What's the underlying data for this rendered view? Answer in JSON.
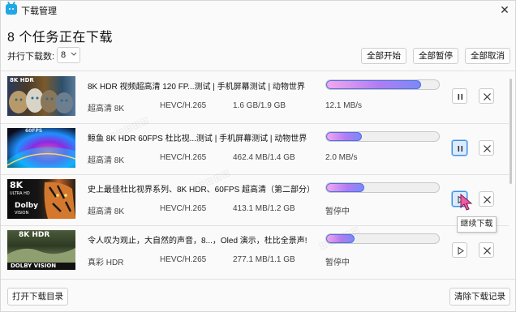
{
  "window": {
    "title": "下载管理",
    "close_glyph": "✕"
  },
  "header": {
    "heading": "8 个任务正在下载",
    "concurrency_label": "并行下载数:",
    "concurrency_value": "8",
    "buttons": {
      "start_all": "全部开始",
      "pause_all": "全部暂停",
      "cancel_all": "全部取消"
    }
  },
  "tasks": [
    {
      "title": "8K HDR 视频超高清 120 FP...测试 | 手机屏幕测试 | 动物世界",
      "quality": "超高清 8K",
      "codec": "HEVC/H.265",
      "size": "1.6 GB/1.9 GB",
      "status": "12.1 MB/s",
      "progress": 0.84,
      "thumb_badge": "8K HDR",
      "state": "downloading",
      "icons": {
        "toggle": "pause-icon",
        "cancel": "close-icon"
      }
    },
    {
      "title": "鲸鱼 8K HDR 60FPS 杜比视...测试 | 手机屏幕测试 | 动物世界",
      "quality": "超高清 8K",
      "codec": "HEVC/H.265",
      "size": "462.4 MB/1.4 GB",
      "status": "2.0 MB/s",
      "progress": 0.32,
      "thumb_badge": "60FPS",
      "state": "downloading",
      "icons": {
        "toggle": "pause-icon",
        "cancel": "close-icon"
      }
    },
    {
      "title": "史上最佳杜比视界系列、8K HDR、60FPS 超高清（第二部分）",
      "quality": "超高清 8K",
      "codec": "HEVC/H.265",
      "size": "413.1 MB/1.2 GB",
      "status": "暂停中",
      "progress": 0.34,
      "thumb_badge": "8K",
      "thumb_sub": "ULTRA HD",
      "thumb_logo": "Dolby",
      "thumb_logo_sub": "VISION",
      "state": "paused",
      "icons": {
        "toggle": "play-icon",
        "cancel": "close-icon"
      }
    },
    {
      "title": "令人叹为观止，大自然的声音，8...，Oled 演示，杜比全景声!",
      "quality": "真彩 HDR",
      "codec": "HEVC/H.265",
      "size": "277.1 MB/1.1 GB",
      "status": "暂停中",
      "progress": 0.25,
      "thumb_badge": "8K HDR",
      "thumb_logo": "DOLBY VISION",
      "state": "paused",
      "icons": {
        "toggle": "play-icon",
        "cancel": "close-icon"
      }
    }
  ],
  "tooltip": "继续下载",
  "footer": {
    "open_folder": "打开下载目录",
    "clear_history": "清除下载记录"
  },
  "colors": {
    "accent": "#4f6ee8",
    "progress_start": "#f3a8ee",
    "progress_end": "#7a8af6",
    "active_button": "#dcebff"
  }
}
